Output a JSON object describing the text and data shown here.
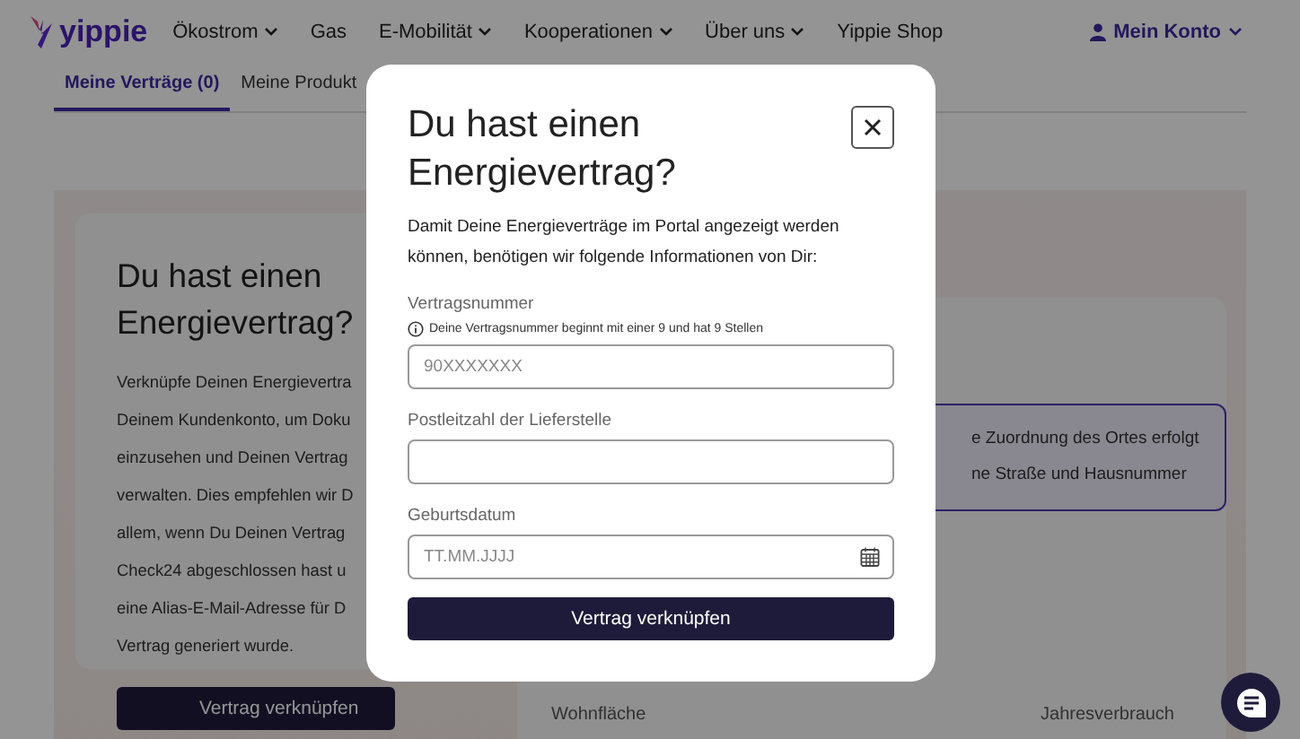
{
  "header": {
    "logo": "yippie",
    "nav": [
      {
        "label": "Ökostrom",
        "dropdown": true
      },
      {
        "label": "Gas",
        "dropdown": false
      },
      {
        "label": "E-Mobilität",
        "dropdown": true
      },
      {
        "label": "Kooperationen",
        "dropdown": true
      },
      {
        "label": "Über uns",
        "dropdown": true
      },
      {
        "label": "Yippie Shop",
        "dropdown": false
      }
    ],
    "account": "Mein Konto"
  },
  "tabs": [
    {
      "label": "Meine Verträge (0)",
      "selected": true
    },
    {
      "label": "Meine Produkt",
      "selected": false
    }
  ],
  "contract_card": {
    "title": "Du hast einen Energievertrag?",
    "body_lines": [
      "Verknüpfe Deinen Energievertra",
      "Deinem Kundenkonto, um Doku",
      "einzusehen und Deinen Vertrag",
      "verwalten. Dies empfehlen wir D",
      "allem, wenn Du Deinen Vertrag",
      "Check24 abgeschlossen hast u",
      "eine Alias-E-Mail-Adresse für D",
      "Vertrag generiert wurde."
    ],
    "button": "Vertrag verknüpfen"
  },
  "address_card": {
    "notice_lines": [
      "e Zuordnung des Ortes erfolgt",
      "ne Straße und Hausnummer"
    ],
    "labels": [
      "Wohnfläche",
      "Jahresverbrauch"
    ]
  },
  "modal": {
    "title": "Du hast einen Energievertrag?",
    "intro": "Damit Deine Energieverträge im Portal angezeigt werden können, benötigen wir folgende Informationen von Dir:",
    "fields": [
      {
        "kind": "text",
        "label": "Vertragsnummer",
        "hint": "Deine Vertragsnummer beginnt mit einer 9 und hat 9 Stellen",
        "placeholder": "90XXXXXXX"
      },
      {
        "kind": "text",
        "label": "Postleitzahl der Lieferstelle"
      },
      {
        "kind": "date",
        "label": "Geburtsdatum",
        "placeholder": "TT.MM.JJJJ"
      }
    ],
    "submit": "Vertrag verknüpfen"
  }
}
